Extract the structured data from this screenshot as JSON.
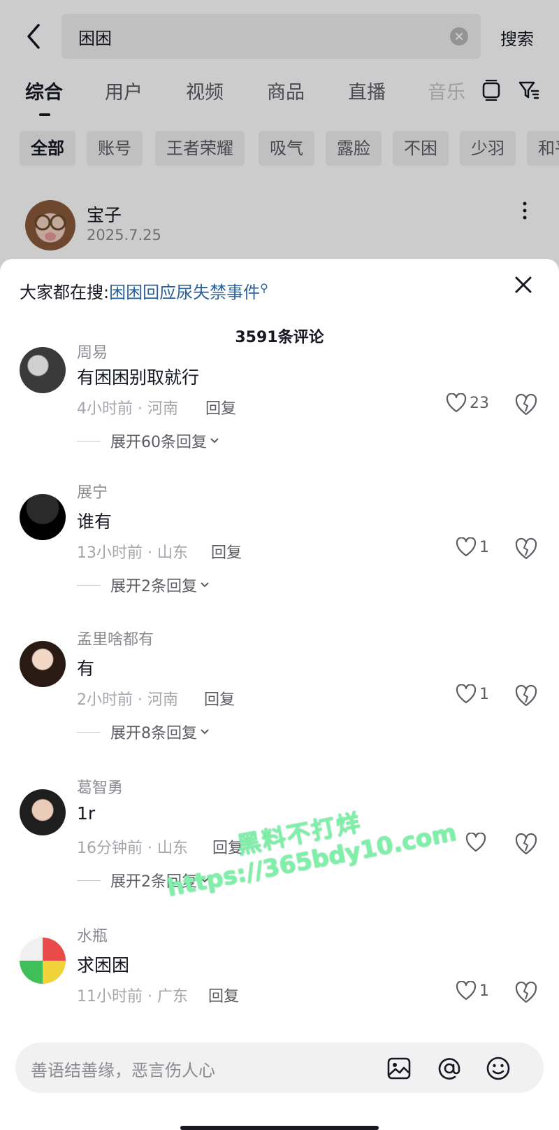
{
  "search": {
    "query": "困困",
    "button_label": "搜索"
  },
  "tabs": [
    {
      "label": "综合",
      "active": true
    },
    {
      "label": "用户"
    },
    {
      "label": "视频"
    },
    {
      "label": "商品"
    },
    {
      "label": "直播"
    },
    {
      "label": "音乐"
    }
  ],
  "chips": [
    {
      "label": "全部",
      "active": true
    },
    {
      "label": "账号"
    },
    {
      "label": "王者荣耀"
    },
    {
      "label": "吸气"
    },
    {
      "label": "露脸"
    },
    {
      "label": "不困"
    },
    {
      "label": "少羽"
    },
    {
      "label": "和平"
    }
  ],
  "post": {
    "username": "宝子",
    "date": "2025.7.25"
  },
  "sheet": {
    "trend_label": "大家都在搜:",
    "trend_link": "困困回应尿失禁事件",
    "comment_count": "3591条评论",
    "input_placeholder": "善语结善缘，恶言伤人心"
  },
  "comments": [
    {
      "name": "周易",
      "text": "有困困别取就行",
      "meta": "4小时前 · 河南",
      "reply": "回复",
      "likes": "23",
      "expand": "展开60条回复"
    },
    {
      "name": "展宁",
      "text": "谁有",
      "meta": "13小时前 · 山东",
      "reply": "回复",
      "likes": "1",
      "expand": "展开2条回复"
    },
    {
      "name": "孟里啥都有",
      "text": "有",
      "meta": "2小时前 · 河南",
      "reply": "回复",
      "likes": "1",
      "expand": "展开8条回复"
    },
    {
      "name": "葛智勇",
      "text": "1r",
      "meta": "16分钟前 · 山东",
      "reply": "回复",
      "likes": "",
      "expand": "展开2条回复"
    },
    {
      "name": "水瓶",
      "text": "求困困",
      "meta": "11小时前 · 广东",
      "reply": "回复",
      "likes": "1",
      "expand": ""
    }
  ],
  "watermark": {
    "line1": "黑料不打烊",
    "line2": "https://365bdy10.com"
  },
  "colors": {
    "link": "#2a5f9e",
    "watermark": "#7ff0a8",
    "dim_overlay": "rgba(0,0,0,0.2)"
  }
}
